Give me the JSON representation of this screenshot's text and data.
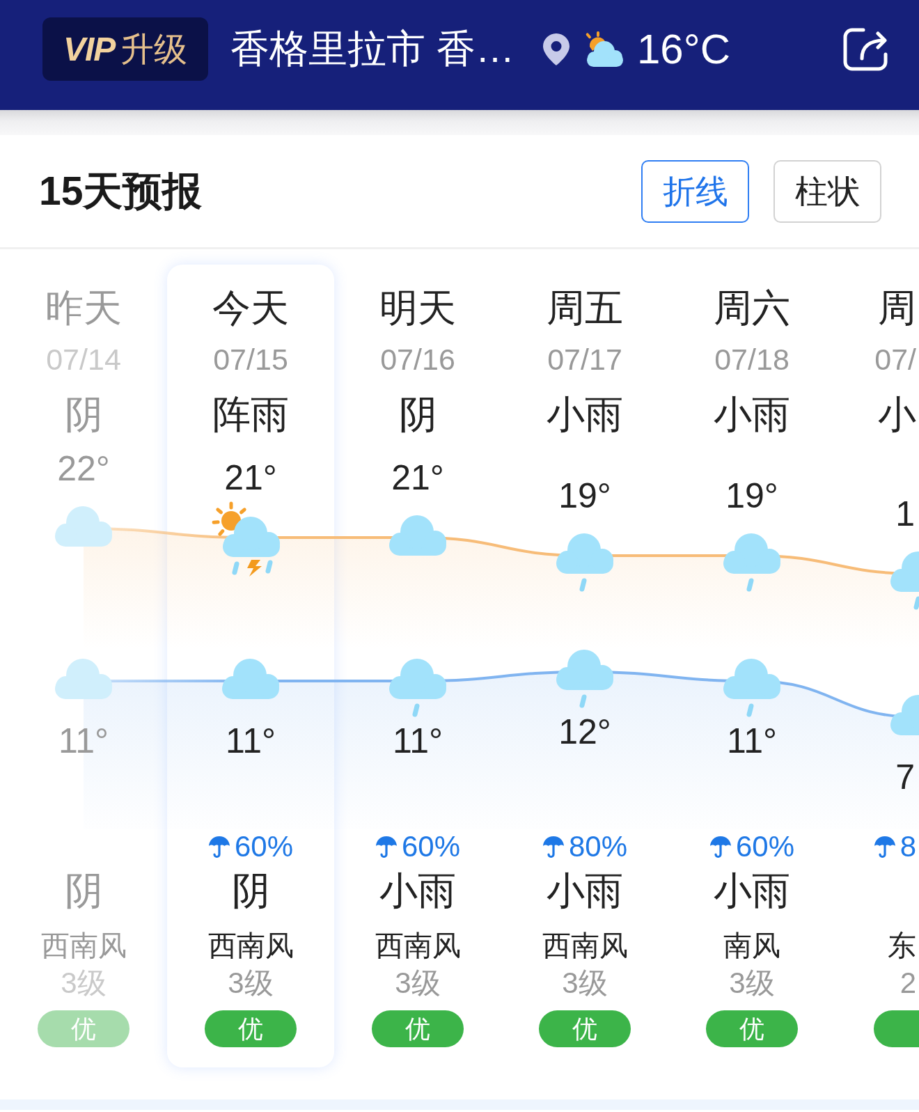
{
  "header": {
    "vip_button": "**VIP**升级",
    "location": "香格里拉市 香…",
    "temperature": "16°C"
  },
  "forecast": {
    "title": "15天预报",
    "view_toggle": [
      {
        "label": "折线",
        "selected": true
      },
      {
        "label": "柱状",
        "selected": false
      }
    ],
    "days": [
      {
        "day": "昨天",
        "date": "07/14",
        "day_weather": "阴",
        "high": "22°",
        "day_icon": {
          "kind": "overcast"
        },
        "night_icon": {
          "kind": "overcast"
        },
        "low": "11°",
        "night_weather": "阴",
        "wind": "西南风",
        "wind_level": "3级",
        "air_quality": "优",
        "past": true,
        "selected": false
      },
      {
        "day": "今天",
        "date": "07/15",
        "day_weather": "阵雨",
        "high": "21°",
        "day_icon": {
          "kind": "shower"
        },
        "night_icon": {
          "kind": "overcast"
        },
        "low": "11°",
        "precipitation": "60%",
        "night_weather": "阴",
        "wind": "西南风",
        "wind_level": "3级",
        "air_quality": "优",
        "past": false,
        "selected": true
      },
      {
        "day": "明天",
        "date": "07/16",
        "day_weather": "阴",
        "high": "21°",
        "day_icon": {
          "kind": "overcast"
        },
        "night_icon": {
          "kind": "light_rain"
        },
        "low": "11°",
        "precipitation": "60%",
        "night_weather": "小雨",
        "wind": "西南风",
        "wind_level": "3级",
        "air_quality": "优",
        "past": false,
        "selected": false
      },
      {
        "day": "周五",
        "date": "07/17",
        "day_weather": "小雨",
        "high": "19°",
        "day_icon": {
          "kind": "light_rain"
        },
        "night_icon": {
          "kind": "light_rain"
        },
        "low": "12°",
        "precipitation": "80%",
        "night_weather": "小雨",
        "wind": "西南风",
        "wind_level": "3级",
        "air_quality": "优",
        "past": false,
        "selected": false
      },
      {
        "day": "周六",
        "date": "07/18",
        "day_weather": "小雨",
        "high": "19°",
        "day_icon": {
          "kind": "light_rain"
        },
        "night_icon": {
          "kind": "light_rain"
        },
        "low": "11°",
        "precipitation": "60%",
        "night_weather": "小雨",
        "wind": "南风",
        "wind_level": "3级",
        "air_quality": "优",
        "past": false,
        "selected": false
      },
      {
        "day": "周",
        "date": "07/",
        "day_weather": "小",
        "high": "1",
        "day_icon": {
          "kind": "light_rain"
        },
        "night_icon": {
          "kind": "overcast"
        },
        "low": "7",
        "precipitation": "8",
        "wind": "东",
        "wind_level": "2",
        "past": false,
        "selected": false
      }
    ]
  }
}
